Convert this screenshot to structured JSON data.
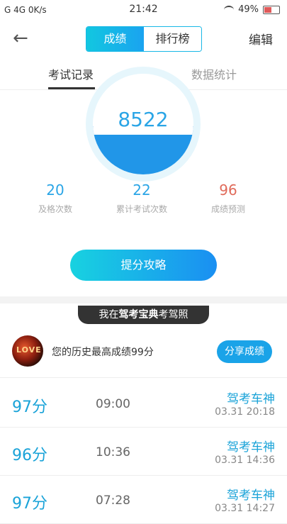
{
  "status_bar": {
    "left_text": "G 4G 0K/s",
    "time": "21:42",
    "battery": "49%",
    "battery_level": 0.49
  },
  "header": {
    "back_icon": "back-arrow-icon",
    "tabs": [
      "成绩",
      "排行榜"
    ],
    "active_tab": 0,
    "edit": "编辑"
  },
  "subtabs": {
    "items": [
      "考试记录",
      "数据统计"
    ],
    "active": 0
  },
  "gauge": {
    "value": "8522"
  },
  "stats": [
    {
      "value": "20",
      "label": "及格次数",
      "color": "#2aa5e6"
    },
    {
      "value": "22",
      "label": "累计考试次数",
      "color": "#2aa5e6"
    },
    {
      "value": "96",
      "label": "成绩预测",
      "color": "#e06a5a"
    }
  ],
  "main_button": "提分攻略",
  "promo": {
    "prefix": "我在",
    "bold": "驾考宝典",
    "suffix": "考驾照"
  },
  "best": {
    "avatar_text": "LOVE",
    "text": "您的历史最高成绩99分",
    "share": "分享成绩"
  },
  "records": [
    {
      "score": "97分",
      "duration": "09:00",
      "title": "驾考车神",
      "date": "03.31  20:18"
    },
    {
      "score": "96分",
      "duration": "10:36",
      "title": "驾考车神",
      "date": "03.31  14:36"
    },
    {
      "score": "97分",
      "duration": "07:28",
      "title": "驾考车神",
      "date": "03.31  14:27"
    }
  ]
}
